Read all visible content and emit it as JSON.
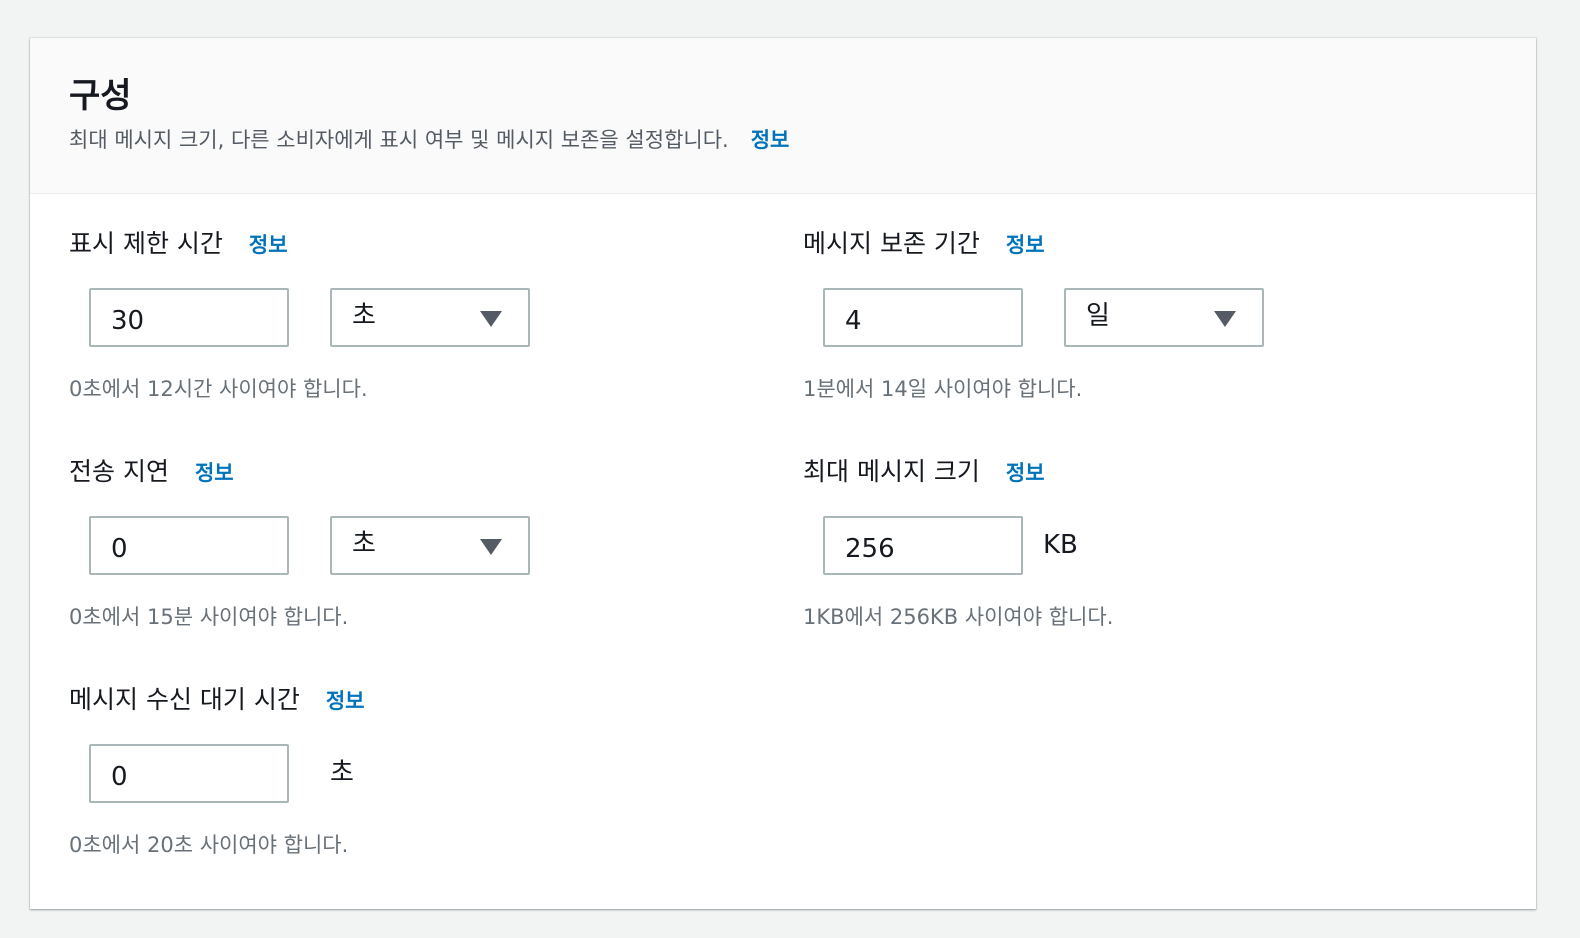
{
  "section": {
    "title": "구성",
    "description": "최대 메시지 크기, 다른 소비자에게 표시 여부 및 메시지 보존을 설정합니다.",
    "info_label": "정보"
  },
  "fields": {
    "visibility_timeout": {
      "label": "표시 제한 시간",
      "info": "정보",
      "value": "30",
      "unit": "초",
      "hint": "0초에서 12시간 사이여야 합니다."
    },
    "message_retention": {
      "label": "메시지 보존 기간",
      "info": "정보",
      "value": "4",
      "unit": "일",
      "hint": "1분에서 14일 사이여야 합니다."
    },
    "delivery_delay": {
      "label": "전송 지연",
      "info": "정보",
      "value": "0",
      "unit": "초",
      "hint": "0초에서 15분 사이여야 합니다."
    },
    "max_message_size": {
      "label": "최대 메시지 크기",
      "info": "정보",
      "value": "256",
      "unit": "KB",
      "hint": "1KB에서 256KB 사이여야 합니다."
    },
    "receive_wait_time": {
      "label": "메시지 수신 대기 시간",
      "info": "정보",
      "value": "0",
      "unit": "초",
      "hint": "0초에서 20초 사이여야 합니다."
    }
  }
}
